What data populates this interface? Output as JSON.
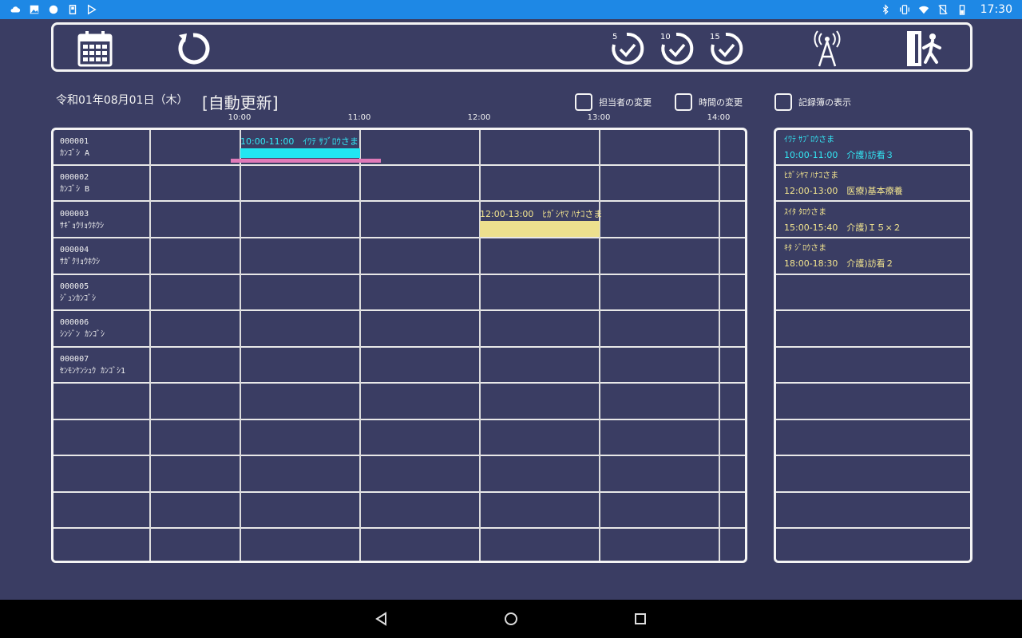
{
  "status_bar": {
    "time": "17:30",
    "left_icons": [
      "cloud-icon",
      "image-icon",
      "circle-icon",
      "sim-icon",
      "play-store-icon"
    ],
    "right_icons": [
      "bluetooth-icon",
      "vibrate-icon",
      "wifi-icon",
      "no-sim-icon",
      "battery-icon"
    ]
  },
  "toolbar": {
    "calendar_icon": "calendar-icon",
    "refresh_icon": "refresh-icon",
    "timer5_label": "5",
    "timer10_label": "10",
    "timer15_label": "15",
    "antenna_icon": "antenna-icon",
    "exit_icon": "exit-icon"
  },
  "header": {
    "date": "令和01年08月01日（木）",
    "auto_update": "[自動更新]",
    "checkboxes": [
      {
        "label": "担当者の変更",
        "checked": false
      },
      {
        "label": "時間の変更",
        "checked": false
      },
      {
        "label": "記録簿の表示",
        "checked": false
      }
    ]
  },
  "timeline": {
    "ticks": [
      "10:00",
      "11:00",
      "12:00",
      "13:00",
      "14:00"
    ]
  },
  "rows": [
    {
      "id": "000001",
      "name": "ｶﾝｺﾞｼ A"
    },
    {
      "id": "000002",
      "name": "ｶﾝｺﾞｼ B"
    },
    {
      "id": "000003",
      "name": "ｻｷﾞｮｳﾘｮｳﾎｳｼ"
    },
    {
      "id": "000004",
      "name": "ｻｶﾞｸﾘｮｳﾎｳｼ"
    },
    {
      "id": "000005",
      "name": "ｼﾞｭﾝｶﾝｺﾞｼ"
    },
    {
      "id": "000006",
      "name": "ｼﾝｼﾞﾝ ｶﾝｺﾞｼ"
    },
    {
      "id": "000007",
      "name": "ｾﾝﾓﾝｹﾝｼｭｳ ｶﾝｺﾞｼ1"
    }
  ],
  "events": [
    {
      "label": "10:00-11:00　ｲﾜﾃ ｻﾌﾞﾛｳさま",
      "color": "#22e6f2",
      "label_color": "#33e8f5"
    },
    {
      "label": "12:00-13:00　ﾋｶﾞｼﾔﾏ ﾊﾅｺさま",
      "color": "#ede08e",
      "label_color": "#f3e58f"
    }
  ],
  "accent_colors": {
    "pink_marker": "#e07ab8",
    "cyan": "#22e6f2",
    "yellow": "#ede08e"
  },
  "side_list": [
    {
      "name": "ｲﾜﾃ ｻﾌﾞﾛｳさま",
      "detail": "10:00-11:00　介護)訪看３",
      "color": "#33e8f5"
    },
    {
      "name": "ﾋｶﾞｼﾔﾏ ﾊﾅｺさま",
      "detail": "12:00-13:00　医療)基本療養",
      "color": "#f3e58f"
    },
    {
      "name": "ｽｲﾀ ﾀﾛｳさま",
      "detail": "15:00-15:40　介護)Ｉ５×２",
      "color": "#f3e58f"
    },
    {
      "name": "ｷﾀ ｼﾞﾛｳさま",
      "detail": "18:00-18:30　介護)訪看２",
      "color": "#f3e58f"
    }
  ]
}
